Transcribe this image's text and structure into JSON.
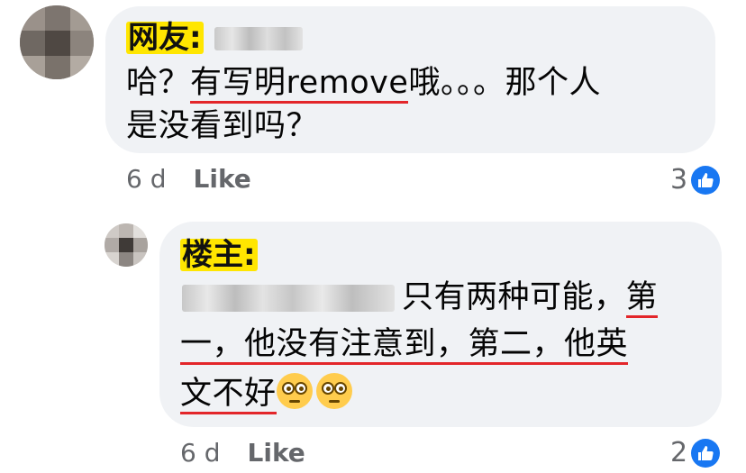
{
  "comments": [
    {
      "tag": "网友:",
      "line1": {
        "pre": "哈？",
        "underlined": "有写明remove",
        "post": "哦。。。那个人"
      },
      "line2": "是没看到吗？",
      "age": "6 d",
      "like_label": "Like",
      "reaction_count": "3",
      "reaction_icon": "thumbs-up-icon"
    },
    {
      "tag": "楼主:",
      "line1": {
        "pre": "只有两种可能，",
        "underlined": "第"
      },
      "line2": "一，他没有注意到，第二，他英",
      "line3": "文不好",
      "age": "6 d",
      "like_label": "Like",
      "reaction_count": "2",
      "reaction_icon": "thumbs-up-icon"
    }
  ],
  "colors": {
    "bubble": "#f0f2f5",
    "tag_highlight": "#ffe600",
    "underline": "#e3262a",
    "like_badge": "#1877f2",
    "meta_text": "#65676b"
  }
}
